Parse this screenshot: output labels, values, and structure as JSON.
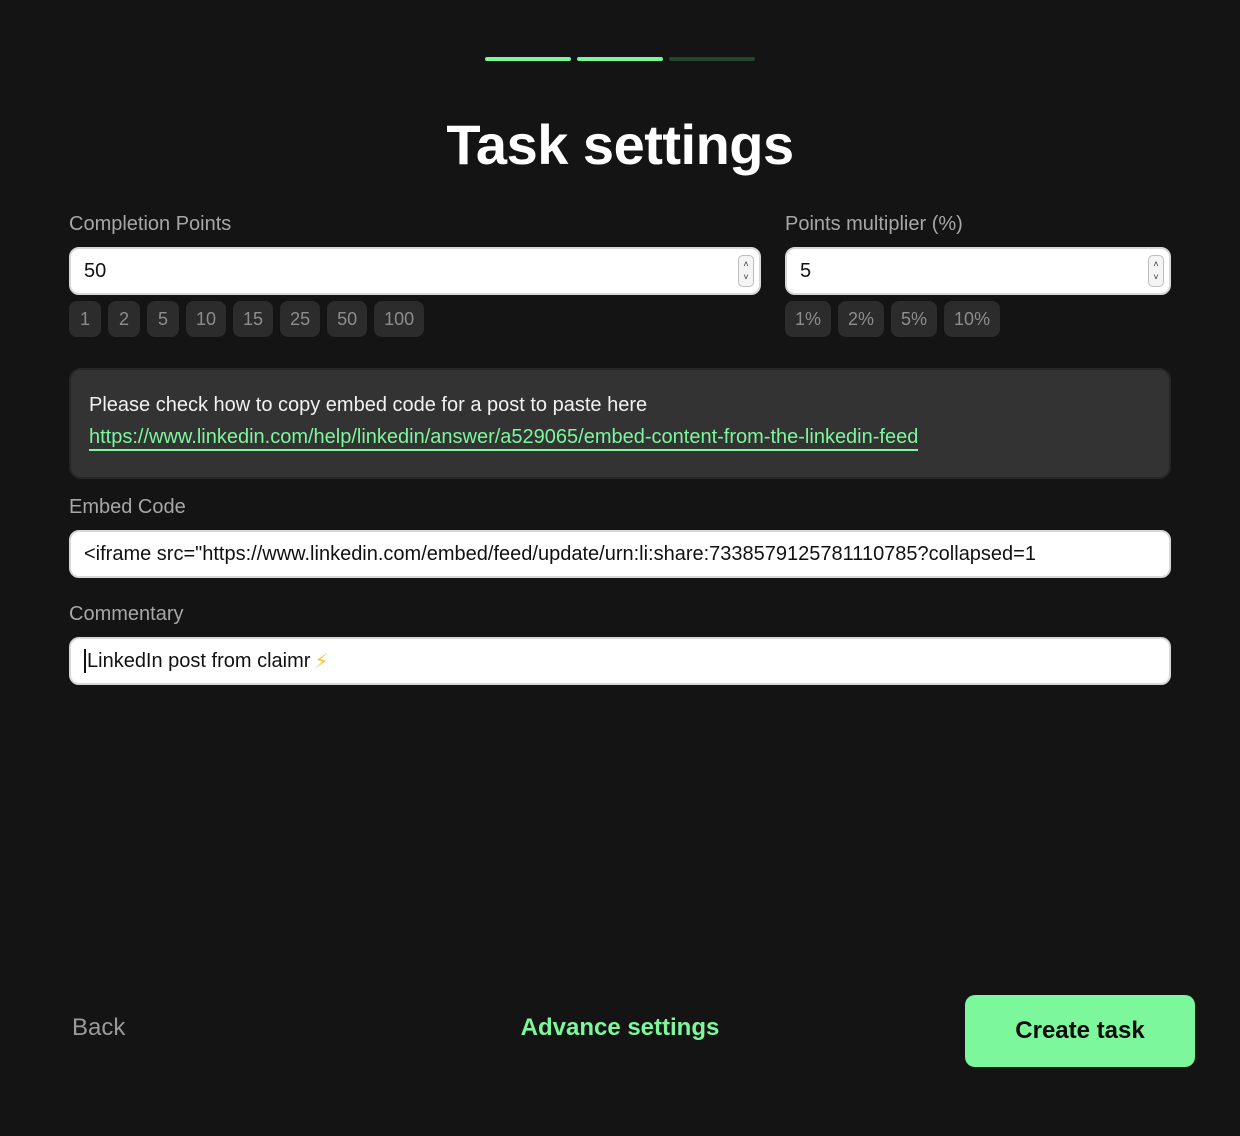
{
  "progress": {
    "total_steps": 3,
    "completed_steps": 2
  },
  "title": "Task settings",
  "completion_points": {
    "label": "Completion Points",
    "value": "50",
    "presets": [
      "1",
      "2",
      "5",
      "10",
      "15",
      "25",
      "50",
      "100"
    ]
  },
  "points_multiplier": {
    "label": "Points multiplier (%)",
    "value": "5",
    "presets": [
      "1%",
      "2%",
      "5%",
      "10%"
    ]
  },
  "info": {
    "text": "Please check how to copy embed code for a post to paste here",
    "link": "https://www.linkedin.com/help/linkedin/answer/a529065/embed-content-from-the-linkedin-feed"
  },
  "embed_code": {
    "label": "Embed Code",
    "value": "<iframe src=\"https://www.linkedin.com/embed/feed/update/urn:li:share:7338579125781110785?collapsed=1"
  },
  "commentary": {
    "label": "Commentary",
    "value": "LinkedIn post from claimr"
  },
  "footer": {
    "back": "Back",
    "advance_settings": "Advance settings",
    "create_task": "Create task"
  },
  "colors": {
    "accent": "#7cf79b",
    "background": "#141414"
  }
}
